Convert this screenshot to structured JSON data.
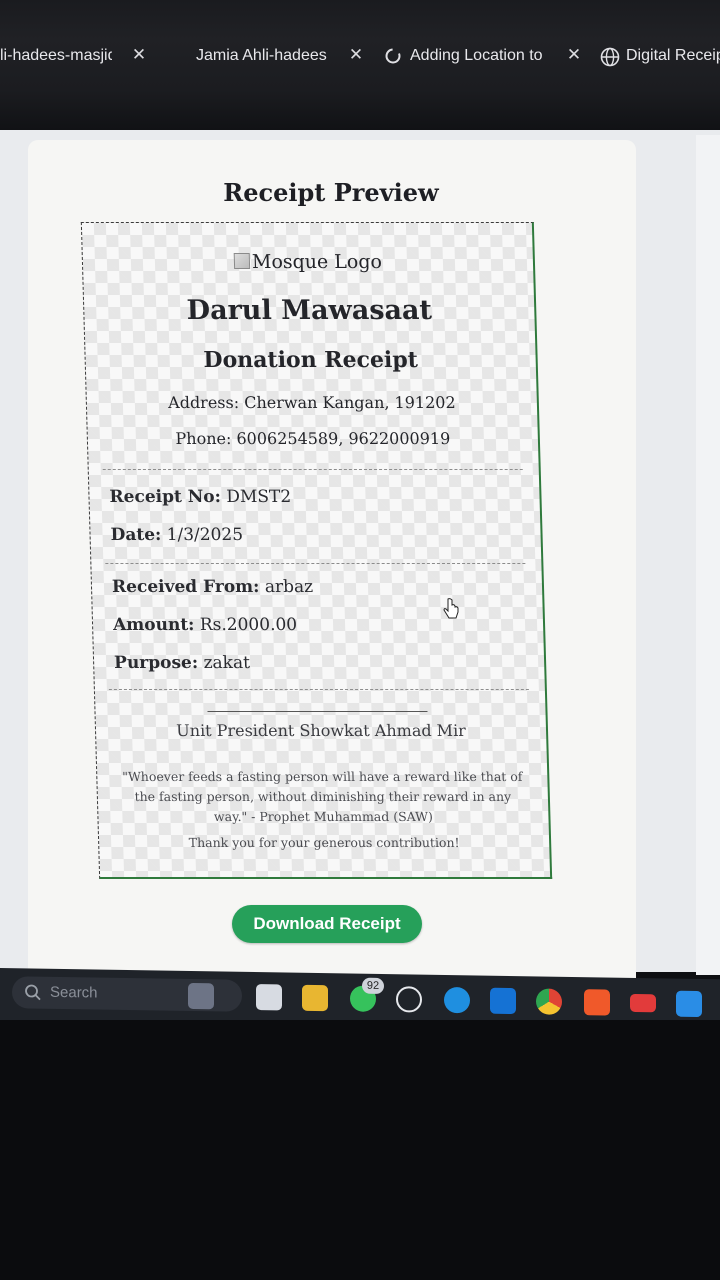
{
  "browser": {
    "tabs": [
      {
        "title": "li-hadees-masjid,"
      },
      {
        "title": "Jamia Ahli-hadees M"
      },
      {
        "title": "Adding Location to"
      },
      {
        "title": "Digital Receip"
      }
    ]
  },
  "page": {
    "heading": "Receipt Preview",
    "receipt": {
      "logo_alt": "Mosque Logo",
      "mosque_name": "Darul Mawasaat",
      "receipt_type": "Donation Receipt",
      "address": "Address: Cherwan Kangan, 191202",
      "phone": "Phone: 6006254589, 9622000919",
      "fields": [
        {
          "label": "Receipt No:",
          "value": "DMST2"
        },
        {
          "label": "Date:",
          "value": "1/3/2025"
        },
        {
          "label": "Received From:",
          "value": "arbaz"
        },
        {
          "label": "Amount:",
          "value": "Rs.2000.00"
        },
        {
          "label": "Purpose:",
          "value": "zakat"
        }
      ],
      "signatory": "Unit President Showkat Ahmad Mir",
      "quote": "\"Whoever feeds a fasting person will have a reward like that of the fasting person, without diminishing their reward in any way.\" - Prophet Muhammad (SAW)",
      "thanks": "Thank you for your generous contribution!"
    },
    "download_button": "Download Receipt"
  },
  "taskbar": {
    "search_placeholder": "Search",
    "whatsapp_badge": "92",
    "icons": [
      "widgets-icon",
      "file-explorer-icon",
      "folder-icon",
      "whatsapp-icon",
      "chatgpt-icon",
      "edge-icon",
      "outlook-icon",
      "chrome-icon",
      "brave-icon",
      "youtube-icon",
      "vscode-icon"
    ]
  }
}
